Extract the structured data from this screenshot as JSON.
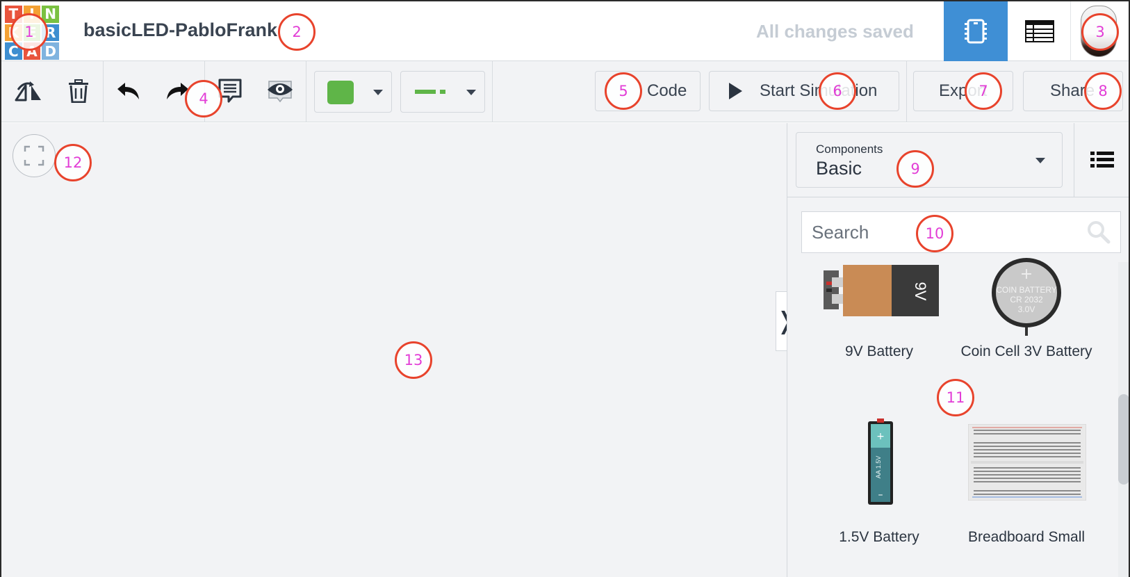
{
  "header": {
    "logo_letters": [
      "T",
      "I",
      "N",
      "K",
      "E",
      "R",
      "C",
      "A",
      "D"
    ],
    "logo_colors": [
      "#e8543d",
      "#f4a134",
      "#7ac141",
      "#f4a134",
      "#7ac141",
      "#3e8ed0",
      "#3e8ed0",
      "#e8543d",
      "#7fb3df"
    ],
    "project_title": "basicLED-PabloFrank",
    "save_status": "All changes saved",
    "view_circuit_icon": "breadboard-view-icon",
    "view_schematic_icon": "schematic-view-icon",
    "avatar_icon": "user-avatar"
  },
  "toolbar": {
    "rotate_icon": "rotate-icon",
    "delete_icon": "trash-icon",
    "undo_icon": "undo-icon",
    "redo_icon": "redo-icon",
    "notes_icon": "notes-icon",
    "visibility_icon": "eye-icon",
    "wire_color": "#5fb548",
    "wire_type_icon": "wire-type-icon",
    "code_label": "Code",
    "simulate_label": "Start Simulation",
    "export_label": "Export",
    "share_label": "Share"
  },
  "panel": {
    "components_label": "Components",
    "components_value": "Basic",
    "list_view_icon": "list-view-icon",
    "search_placeholder": "Search",
    "items": [
      {
        "name": "9V Battery",
        "icon": "9v-battery"
      },
      {
        "name": "Coin Cell 3V Battery",
        "icon": "coin-cell-battery"
      },
      {
        "name": "1.5V Battery",
        "icon": "aa-battery"
      },
      {
        "name": "Breadboard Small",
        "icon": "breadboard"
      }
    ],
    "battery_9v_text": "9V",
    "coin_text": [
      "COIN BATTERY",
      "CR 2032",
      "3.0V"
    ],
    "aa_text": "AA 1.5V"
  },
  "annotations": [
    "1",
    "2",
    "3",
    "4",
    "5",
    "6",
    "7",
    "8",
    "9",
    "10",
    "11",
    "12",
    "13"
  ]
}
